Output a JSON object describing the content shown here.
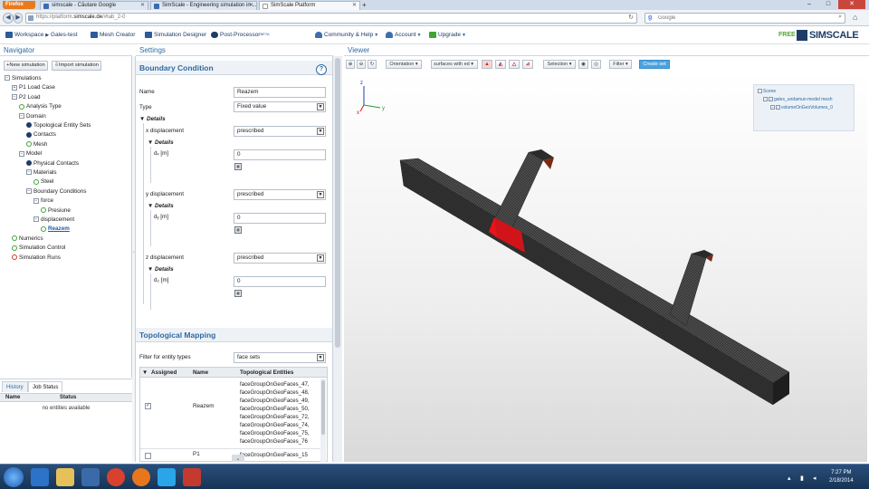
{
  "browser": {
    "menu_button": "Firefox",
    "tabs": [
      {
        "label": "simscale - Căutare Google"
      },
      {
        "label": "SimScale - Engineering simulation in ..."
      },
      {
        "label": "SimScale Platform"
      }
    ],
    "new_tab": "+",
    "url_prefix": "https://platform.",
    "url_host": "simscale.de",
    "url_path": "/#tab_2-0",
    "search_engine_label": "g",
    "search_placeholder": "Google",
    "window_controls": {
      "minimize": "–",
      "maximize": "□",
      "close": "✕"
    }
  },
  "toolbar": {
    "breadcrumb": {
      "root": "Workspace",
      "separator": "▶",
      "project": "Gales-test"
    },
    "mesh_creator": "Mesh Creator",
    "simulation_designer": "Simulation Designer",
    "post_processor": "Post-Processor",
    "beta": "BETA",
    "community": "Community & Help",
    "account": "Account",
    "upgrade": "Upgrade",
    "plan": "FREE",
    "logo_text": "SIMSCALE"
  },
  "navigator": {
    "title": "Navigator",
    "new_simulation": "New simulation",
    "import_simulation": "Import simulation",
    "tree": [
      {
        "label": "Simulations",
        "status": "none",
        "expander": "−",
        "indent": 0
      },
      {
        "label": "P1 Load Case",
        "status": "none",
        "expander": "+",
        "indent": 1
      },
      {
        "label": "P2 Load",
        "status": "none",
        "expander": "−",
        "indent": 1
      },
      {
        "label": "Analysis Type",
        "status": "green",
        "expander": "",
        "indent": 2
      },
      {
        "label": "Domain",
        "status": "none",
        "expander": "−",
        "indent": 2
      },
      {
        "label": "Topological Entity Sets",
        "status": "blue",
        "expander": "",
        "indent": 3
      },
      {
        "label": "Contacts",
        "status": "blue",
        "expander": "",
        "indent": 3
      },
      {
        "label": "Mesh",
        "status": "green",
        "expander": "",
        "indent": 3
      },
      {
        "label": "Model",
        "status": "none",
        "expander": "−",
        "indent": 2
      },
      {
        "label": "Physical Contacts",
        "status": "blue",
        "expander": "",
        "indent": 3
      },
      {
        "label": "Materials",
        "status": "none",
        "expander": "−",
        "indent": 3
      },
      {
        "label": "Steel",
        "status": "green",
        "expander": "",
        "indent": 4
      },
      {
        "label": "Boundary Conditions",
        "status": "none",
        "expander": "−",
        "indent": 3
      },
      {
        "label": "force",
        "status": "none",
        "expander": "−",
        "indent": 4
      },
      {
        "label": "Presiune",
        "status": "green",
        "expander": "",
        "indent": 5
      },
      {
        "label": "displacement",
        "status": "none",
        "expander": "−",
        "indent": 4
      },
      {
        "label": "Reazem",
        "status": "green",
        "expander": "",
        "indent": 5,
        "selected": true
      },
      {
        "label": "Numerics",
        "status": "green",
        "expander": "",
        "indent": 1
      },
      {
        "label": "Simulation Control",
        "status": "green",
        "expander": "",
        "indent": 1
      },
      {
        "label": "Simulation Runs",
        "status": "red",
        "expander": "",
        "indent": 1
      }
    ]
  },
  "jobs": {
    "tab_history": "History",
    "tab_job_status": "Job Status",
    "col_name": "Name",
    "col_status": "Status",
    "empty": "no entities available"
  },
  "settings": {
    "title": "Settings",
    "section_bc": "Boundary Condition",
    "help": "?",
    "name_label": "Name",
    "name_value": "Reazem",
    "type_label": "Type",
    "type_value": "Fixed value",
    "details": "Details",
    "x_label": "x displacement",
    "x_value": "prescribed",
    "dx_label": "dₓ [m]",
    "dx_value": "0",
    "y_label": "y displacement",
    "y_value": "prescribed",
    "dy_label": "dᵧ [m]",
    "dy_value": "0",
    "z_label": "z displacement",
    "z_value": "prescribed",
    "dz_label": "d₂ [m]",
    "dz_value": "0",
    "section_tm": "Topological Mapping",
    "filter_label": "Filter for entity types",
    "filter_value": "face sets",
    "col_assigned": "Assigned",
    "col_name": "Name",
    "col_entities": "Topological Entities",
    "rows": [
      {
        "name": "Reazem",
        "checked": true,
        "entities": [
          "faceGroupOnGeoFaces_47,",
          "faceGroupOnGeoFaces_48,",
          "faceGroupOnGeoFaces_49,",
          "faceGroupOnGeoFaces_50,",
          "faceGroupOnGeoFaces_72,",
          "faceGroupOnGeoFaces_74,",
          "faceGroupOnGeoFaces_75,",
          "faceGroupOnGeoFaces_76"
        ]
      },
      {
        "name": "P1",
        "checked": false,
        "entities": [
          "faceGroupOnGeoFaces_15"
        ]
      }
    ]
  },
  "viewer": {
    "title": "Viewer",
    "orientation": "Orientation",
    "render_mode": "surfaces with ed",
    "selection": "Selection",
    "filter": "Filter",
    "create_set": "Create set",
    "scene_root": "Scene",
    "scene_mesh": "gales_undamun-model mesh",
    "scene_volumes": "volumeOnGeoVolumes_0",
    "axis_x": "x",
    "axis_y": "y",
    "axis_z": "z"
  },
  "taskbar": {
    "time": "7:27 PM",
    "date": "2/18/2014"
  },
  "colors": {
    "accent": "#2f6aa3",
    "brand_navy": "#1d3c66",
    "status_green": "#3fa535",
    "status_red": "#d23a2a",
    "selection_red": "#d0141a",
    "plan_green": "#55a532"
  }
}
